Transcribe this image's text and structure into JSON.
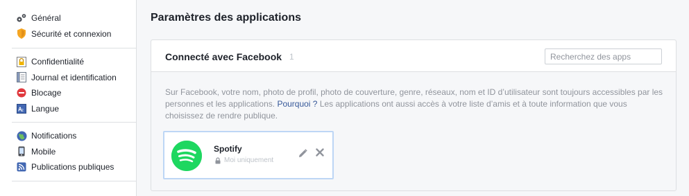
{
  "sidebar": {
    "groups": [
      [
        {
          "label": "Général",
          "icon": "gears-icon"
        },
        {
          "label": "Sécurité et connexion",
          "icon": "shield-icon"
        }
      ],
      [
        {
          "label": "Confidentialité",
          "icon": "lock-icon"
        },
        {
          "label": "Journal et identification",
          "icon": "journal-icon"
        },
        {
          "label": "Blocage",
          "icon": "block-icon"
        },
        {
          "label": "Langue",
          "icon": "language-icon"
        }
      ],
      [
        {
          "label": "Notifications",
          "icon": "globe-icon"
        },
        {
          "label": "Mobile",
          "icon": "mobile-icon"
        },
        {
          "label": "Publications publiques",
          "icon": "rss-icon"
        }
      ]
    ]
  },
  "main": {
    "title": "Paramètres des applications",
    "panel": {
      "title": "Connecté avec Facebook",
      "count": "1",
      "search_placeholder": "Recherchez des apps",
      "info_before": "Sur Facebook, votre nom, photo de profil, photo de couverture, genre, réseaux, nom et ID d’utilisateur sont toujours accessibles par les personnes et les applications. ",
      "info_link": "Pourquoi ?",
      "info_after": " Les applications ont aussi accès à votre liste d’amis et à toute information que vous choisissez de rendre publique."
    },
    "apps": [
      {
        "name": "Spotify",
        "privacy": "Moi uniquement",
        "logo_color": "#1ed760"
      }
    ]
  },
  "colors": {
    "link": "#365899",
    "muted": "#90949c",
    "border": "#dddfe2",
    "card_border": "#bdd6f5"
  }
}
